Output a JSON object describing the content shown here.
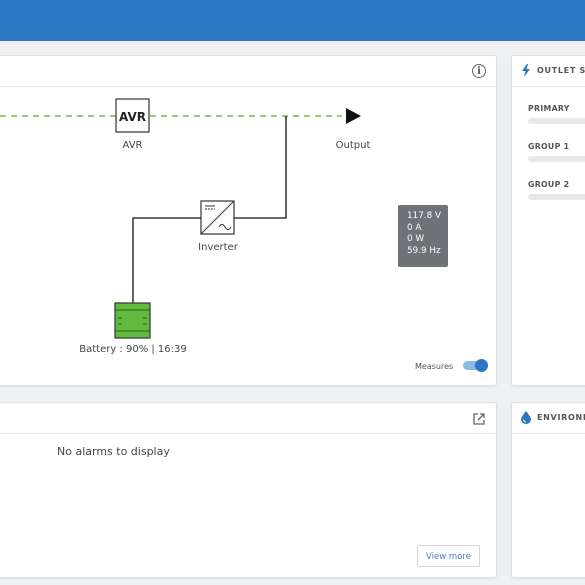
{
  "header": {
    "bar_color": "#2b77c3"
  },
  "diagram": {
    "avr_box_label": "AVR",
    "avr_label": "AVR",
    "output_label": "Output",
    "inverter_label": "Inverter",
    "battery_label": "Battery : 90% | 16:39",
    "readout": {
      "voltage": "117.8 V",
      "current": "0 A",
      "power": "0 W",
      "frequency": "59.9 Hz"
    },
    "measures_label": "Measures",
    "measures_on": true,
    "bypass_line_color": "#6cc04a",
    "battery_color": "#62bb3f",
    "info_icon": "info-icon"
  },
  "outlets": {
    "title": "OUTLET STA",
    "icon": "bolt-icon",
    "groups": [
      {
        "label": "PRIMARY"
      },
      {
        "label": "GROUP 1"
      },
      {
        "label": "GROUP 2"
      }
    ]
  },
  "alarms": {
    "empty_message": "No alarms to display",
    "view_more_label": "View more",
    "icon": "external-link-icon"
  },
  "environment": {
    "title": "ENVIRONM",
    "icon": "drop-icon"
  }
}
